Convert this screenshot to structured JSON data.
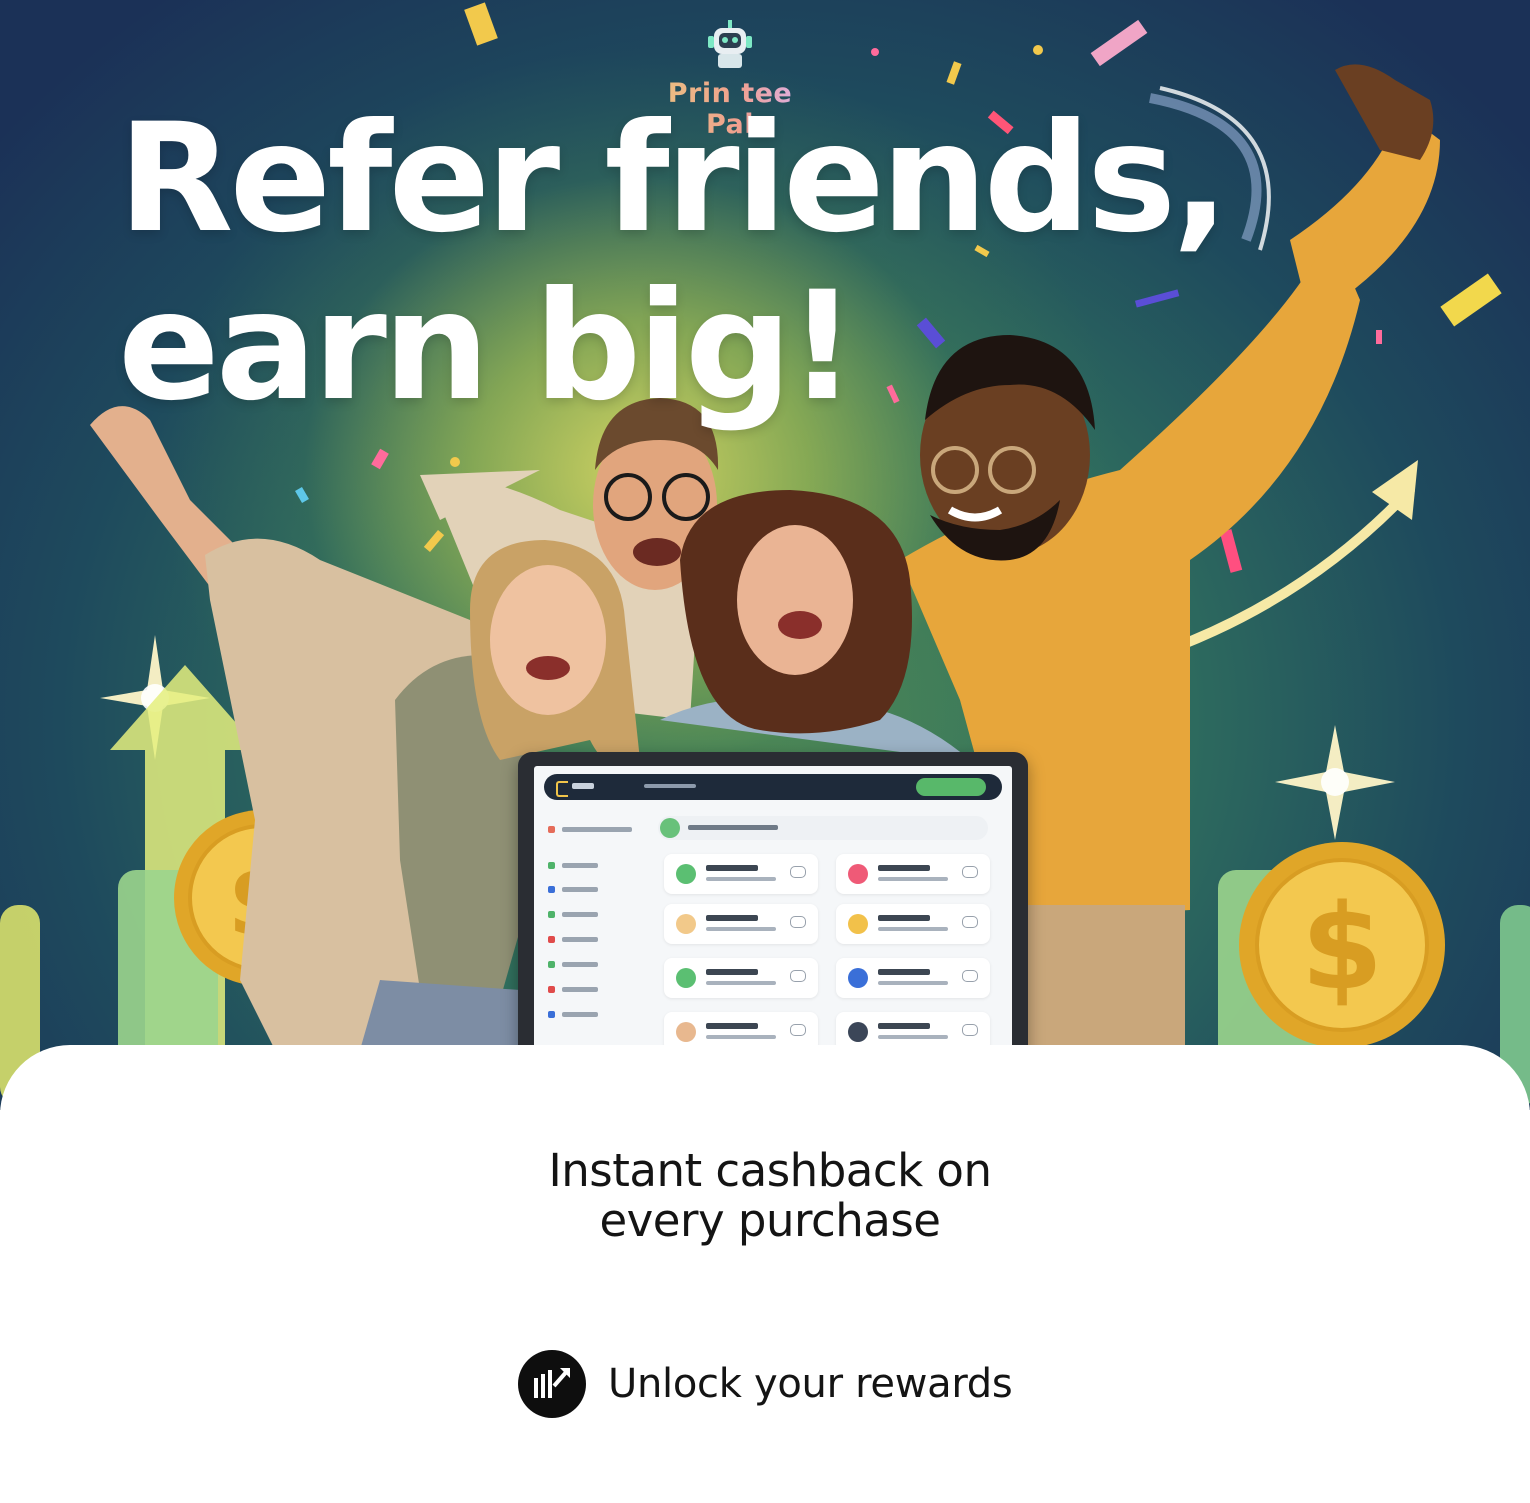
{
  "brand": {
    "name": "Prin tee Pal",
    "logo_icon": "robot-icon"
  },
  "headline": {
    "line1": "Refer friends,",
    "line2": "earn big!"
  },
  "cashback": {
    "line1": "Instant cashback on",
    "line2": "every purchase"
  },
  "cta": {
    "label": "Unlock your rewards",
    "icon": "rewards-icon"
  },
  "colors": {
    "hero_top": "#1b3157",
    "hero_glow": "#d6d662",
    "coin_gold": "#e8b838",
    "brand_text": "#e8c77e",
    "cta_icon_bg": "#0e0e0e",
    "text_dark": "#141414"
  }
}
